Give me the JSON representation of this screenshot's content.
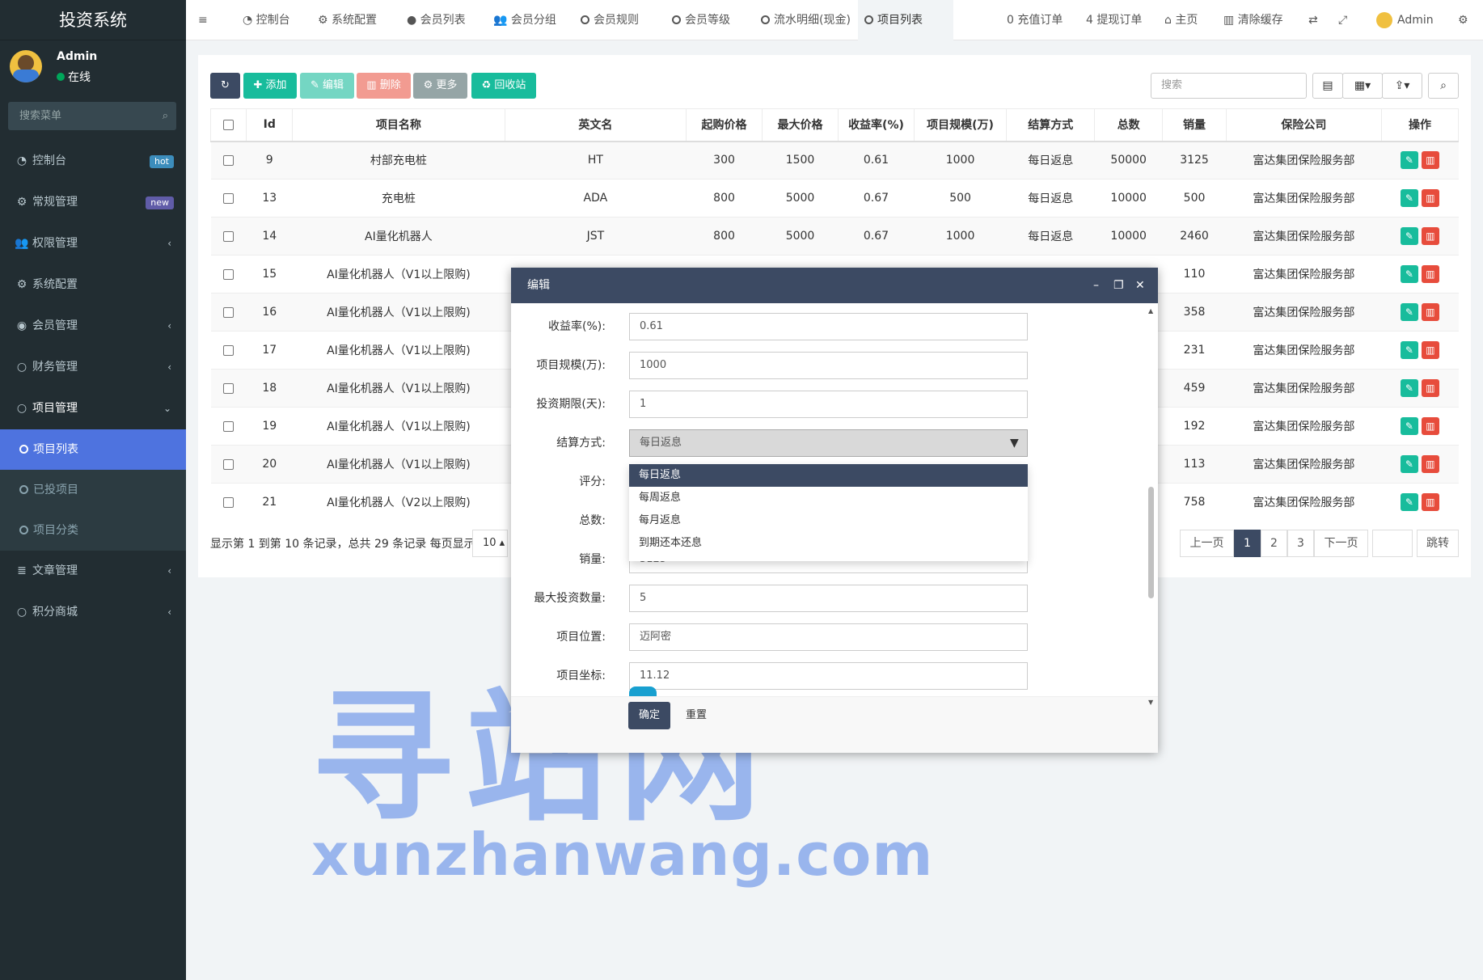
{
  "app": {
    "title": "投资系统",
    "user": "Admin",
    "status": "在线",
    "search_placeholder": "搜索菜单"
  },
  "sidebar": {
    "items": [
      {
        "label": "控制台",
        "icon": "dashboard-icon",
        "badge": "hot",
        "badge_color": "#3c8dbc"
      },
      {
        "label": "常规管理",
        "icon": "cogs-icon",
        "badge": "new",
        "badge_color": "#605ca8"
      },
      {
        "label": "权限管理",
        "icon": "group-icon",
        "arrow": "‹"
      },
      {
        "label": "系统配置",
        "icon": "gear-icon"
      },
      {
        "label": "会员管理",
        "icon": "user-circle-icon",
        "arrow": "‹"
      },
      {
        "label": "财务管理",
        "icon": "circle-icon",
        "arrow": "‹"
      },
      {
        "label": "项目管理",
        "icon": "circle-icon",
        "arrow": "⌄"
      }
    ],
    "sub": [
      "项目列表",
      "已投项目",
      "项目分类"
    ],
    "items2": [
      {
        "label": "文章管理",
        "icon": "list-icon",
        "arrow": "‹"
      },
      {
        "label": "积分商城",
        "icon": "circle-icon",
        "arrow": "‹"
      }
    ]
  },
  "topbar": {
    "tabs": [
      "控制台",
      "系统配置",
      "会员列表",
      "会员分组",
      "会员规则",
      "会员等级",
      "流水明细(现金)",
      "项目列表"
    ],
    "right": [
      "0 充值订单",
      "4 提现订单",
      "主页",
      "清除缓存",
      "Admin"
    ]
  },
  "toolbar": {
    "add": "添加",
    "edit": "编辑",
    "delete": "删除",
    "more": "更多",
    "recycle": "回收站",
    "search_placeholder": "搜索"
  },
  "table": {
    "headers": [
      "Id",
      "项目名称",
      "英文名",
      "起购价格",
      "最大价格",
      "收益率(%)",
      "项目规模(万)",
      "结算方式",
      "总数",
      "销量",
      "保险公司",
      "操作"
    ],
    "rows": [
      [
        "9",
        "村部充电桩",
        "HT",
        "300",
        "1500",
        "0.61",
        "1000",
        "每日返息",
        "50000",
        "3125",
        "富达集团保险服务部"
      ],
      [
        "13",
        "充电桩",
        "ADA",
        "800",
        "5000",
        "0.67",
        "500",
        "每日返息",
        "10000",
        "500",
        "富达集团保险服务部"
      ],
      [
        "14",
        "AI量化机器人",
        "JST",
        "800",
        "5000",
        "0.67",
        "1000",
        "每日返息",
        "10000",
        "2460",
        "富达集团保险服务部"
      ],
      [
        "15",
        "AI量化机器人（V1以上限购)",
        "",
        "",
        "",
        "",
        "",
        "",
        "",
        "110",
        "富达集团保险服务部"
      ],
      [
        "16",
        "AI量化机器人（V1以上限购)",
        "",
        "",
        "",
        "",
        "",
        "",
        "",
        "358",
        "富达集团保险服务部"
      ],
      [
        "17",
        "AI量化机器人（V1以上限购)",
        "",
        "",
        "",
        "",
        "",
        "",
        "",
        "231",
        "富达集团保险服务部"
      ],
      [
        "18",
        "AI量化机器人（V1以上限购)",
        "",
        "",
        "",
        "",
        "",
        "",
        "",
        "459",
        "富达集团保险服务部"
      ],
      [
        "19",
        "AI量化机器人（V1以上限购)",
        "",
        "",
        "",
        "",
        "",
        "",
        "",
        "192",
        "富达集团保险服务部"
      ],
      [
        "20",
        "AI量化机器人（V1以上限购)",
        "",
        "",
        "",
        "",
        "",
        "",
        "",
        "113",
        "富达集团保险服务部"
      ],
      [
        "21",
        "AI量化机器人（V2以上限购)",
        "",
        "",
        "",
        "",
        "",
        "",
        "",
        "758",
        "富达集团保险服务部"
      ]
    ]
  },
  "pagination": {
    "info": "显示第 1 到第 10 条记录，总共 29 条记录 每页显示",
    "per_page": "10 ▴",
    "prev": "上一页",
    "pages": [
      "1",
      "2",
      "3"
    ],
    "next": "下一页",
    "jump": "跳转"
  },
  "dialog": {
    "title": "编辑",
    "fields": [
      {
        "label": "收益率(%):",
        "value": "0.61"
      },
      {
        "label": "项目规模(万):",
        "value": "1000"
      },
      {
        "label": "投资期限(天):",
        "value": "1"
      },
      {
        "label": "结算方式:",
        "value": "每日返息"
      },
      {
        "label": "评分:",
        "value": ""
      },
      {
        "label": "总数:",
        "value": ""
      },
      {
        "label": "销量:",
        "value": "3125"
      },
      {
        "label": "最大投资数量:",
        "value": "5"
      },
      {
        "label": "项目位置:",
        "value": "迈阿密"
      },
      {
        "label": "项目坐标:",
        "value": "11.12"
      }
    ],
    "options": [
      "每日返息",
      "每周返息",
      "每月返息",
      "到期还本还息"
    ],
    "ok": "确定",
    "reset": "重置"
  },
  "watermark": {
    "cn": "寻站网",
    "url": "xunzhanwang.com"
  }
}
